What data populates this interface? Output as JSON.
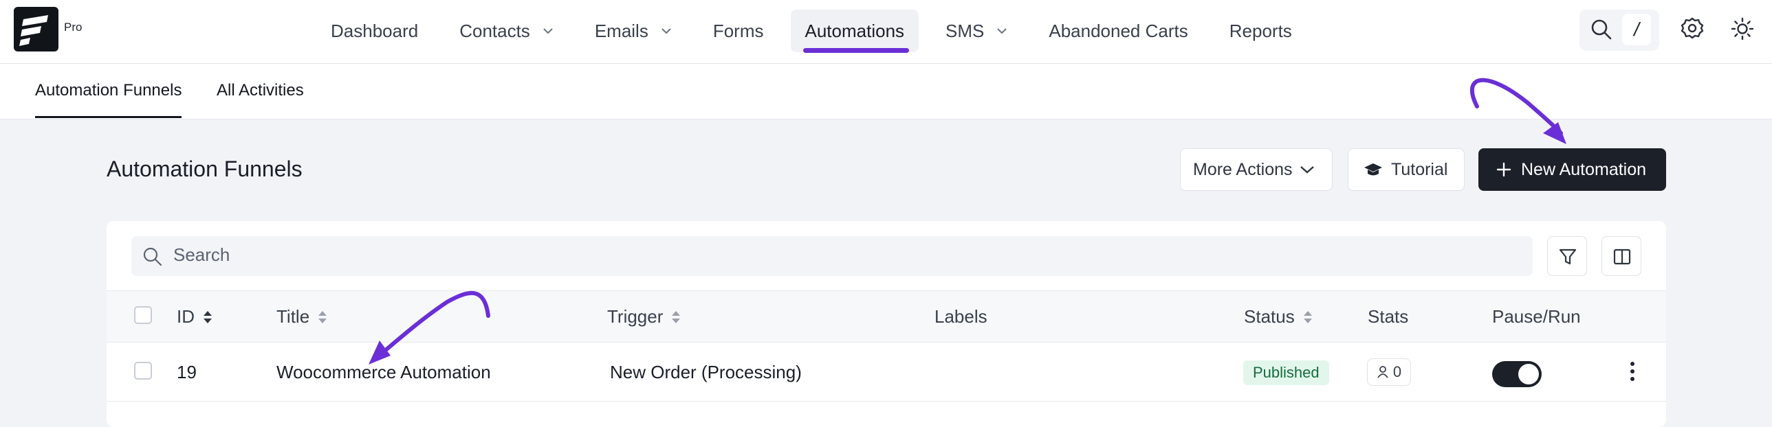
{
  "brand": {
    "suffix": "Pro"
  },
  "nav": {
    "items": [
      {
        "label": "Dashboard",
        "dropdown": false,
        "active": false
      },
      {
        "label": "Contacts",
        "dropdown": true,
        "active": false
      },
      {
        "label": "Emails",
        "dropdown": true,
        "active": false
      },
      {
        "label": "Forms",
        "dropdown": false,
        "active": false
      },
      {
        "label": "Automations",
        "dropdown": false,
        "active": true
      },
      {
        "label": "SMS",
        "dropdown": true,
        "active": false
      },
      {
        "label": "Abandoned Carts",
        "dropdown": false,
        "active": false
      },
      {
        "label": "Reports",
        "dropdown": false,
        "active": false
      }
    ],
    "search_shortcut": "/",
    "icons": [
      "search-icon",
      "gear-icon",
      "sun-icon"
    ]
  },
  "subnav": {
    "tabs": [
      "Automation Funnels",
      "All Activities"
    ],
    "active": "Automation Funnels"
  },
  "page": {
    "title": "Automation Funnels",
    "more_actions": "More Actions",
    "tutorial": "Tutorial",
    "new_automation": "New Automation"
  },
  "search": {
    "placeholder": "Search"
  },
  "table": {
    "columns": [
      "ID",
      "Title",
      "Trigger",
      "Labels",
      "Status",
      "Stats",
      "Pause/Run"
    ],
    "rows": [
      {
        "id": "19",
        "title": "Woocommerce Automation",
        "trigger": "New Order (Processing)",
        "labels": "",
        "status": "Published",
        "stats": "0",
        "running": true
      }
    ]
  },
  "colors": {
    "accent": "#6a2fd6",
    "dark": "#1c2029",
    "published_bg": "#e3f6ec",
    "published_text": "#156c3c"
  }
}
